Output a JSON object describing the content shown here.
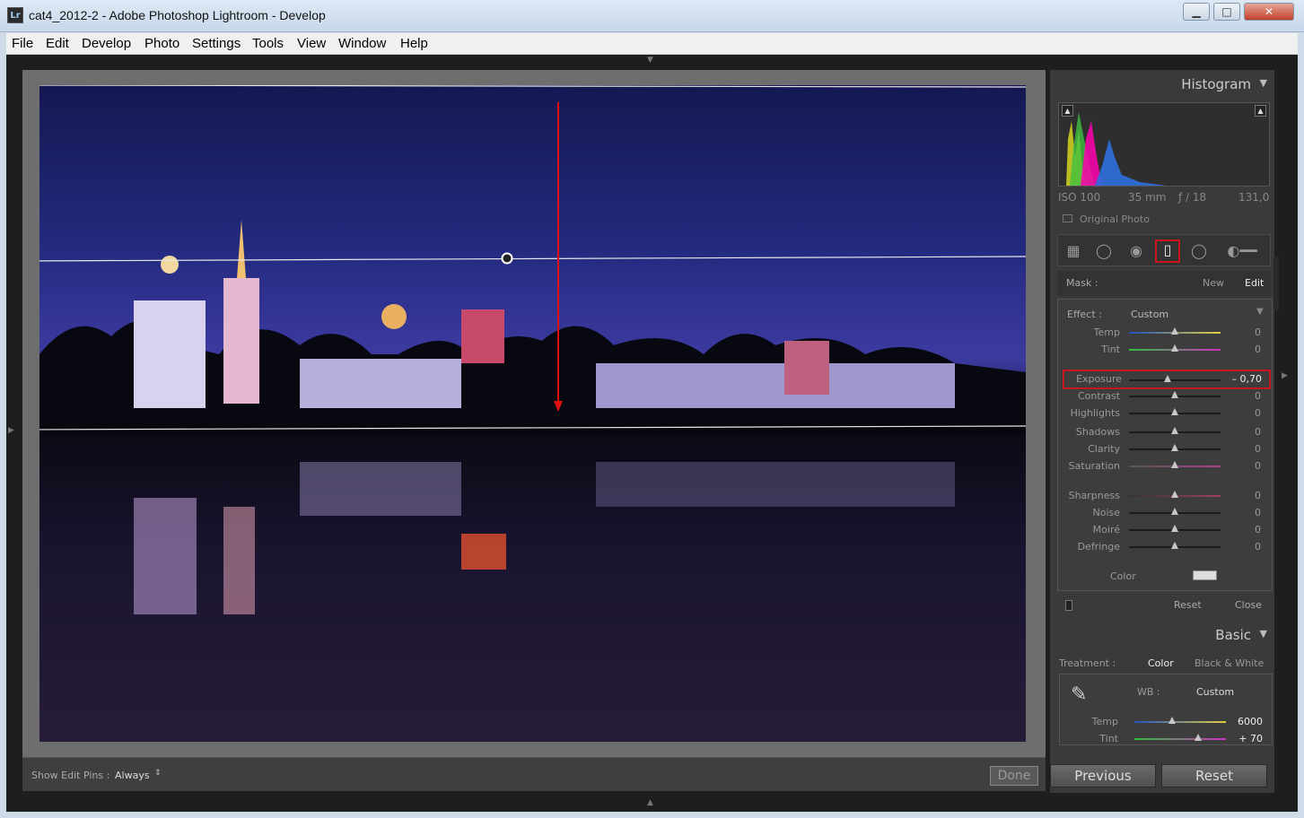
{
  "window": {
    "app_icon": "Lr",
    "title": "cat4_2012-2 - Adobe Photoshop Lightroom - Develop",
    "buttons": {
      "minimize": "▁",
      "maximize": "□",
      "close": "✕"
    }
  },
  "menu": [
    "File",
    "Edit",
    "Develop",
    "Photo",
    "Settings",
    "Tools",
    "View",
    "Window",
    "Help"
  ],
  "toolbar": {
    "show_edit_pins_label": "Show Edit Pins :",
    "show_edit_pins_value": "Always",
    "done_label": "Done"
  },
  "histogram": {
    "title": "Histogram",
    "iso": "ISO 100",
    "focal": "35 mm",
    "aperture": "ƒ / 18",
    "shutter": "131,0",
    "original_photo": "Original Photo"
  },
  "mask": {
    "label": "Mask :",
    "new": "New",
    "edit": "Edit"
  },
  "effect": {
    "label": "Effect :",
    "value": "Custom",
    "sliders": [
      {
        "label": "Temp",
        "value": "0",
        "pos": 0.5
      },
      {
        "label": "Tint",
        "value": "0",
        "pos": 0.5
      },
      {
        "label": "Exposure",
        "value": "– 0,70",
        "pos": 0.42
      },
      {
        "label": "Contrast",
        "value": "0",
        "pos": 0.5
      },
      {
        "label": "Highlights",
        "value": "0",
        "pos": 0.5
      },
      {
        "label": "Shadows",
        "value": "0",
        "pos": 0.5
      },
      {
        "label": "Clarity",
        "value": "0",
        "pos": 0.5
      },
      {
        "label": "Saturation",
        "value": "0",
        "pos": 0.5
      },
      {
        "label": "Sharpness",
        "value": "0",
        "pos": 0.5
      },
      {
        "label": "Noise",
        "value": "0",
        "pos": 0.5
      },
      {
        "label": "Moiré",
        "value": "0",
        "pos": 0.5
      },
      {
        "label": "Defringe",
        "value": "0",
        "pos": 0.5
      }
    ],
    "color_label": "Color",
    "reset": "Reset",
    "close": "Close"
  },
  "basic": {
    "title": "Basic",
    "treatment_label": "Treatment :",
    "treatment_color": "Color",
    "treatment_bw": "Black & White",
    "wb_label": "WB :",
    "wb_value": "Custom",
    "temp_label": "Temp",
    "temp_value": "6000",
    "temp_pos": 0.41,
    "tint_label": "Tint",
    "tint_value": "+ 70",
    "tint_pos": 0.7
  },
  "nav": {
    "previous": "Previous",
    "reset": "Reset"
  },
  "colors": {
    "highlight_red": "#c9151e",
    "panel_bg": "#3a3a3a"
  }
}
